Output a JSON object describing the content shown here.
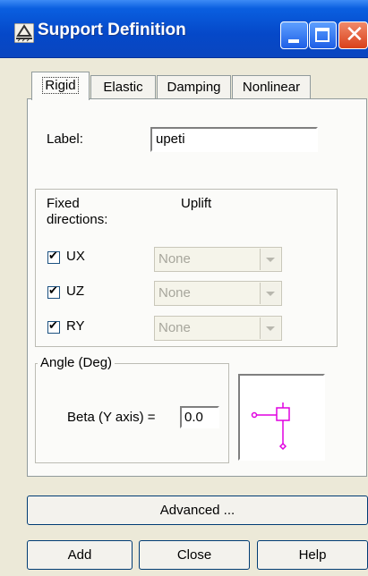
{
  "window": {
    "title": "Support Definition"
  },
  "tabs": [
    "Rigid",
    "Elastic",
    "Damping",
    "Nonlinear"
  ],
  "label_field": {
    "label": "Label:",
    "value": "upeti"
  },
  "fixed": {
    "heading": "Fixed directions:",
    "uplift_heading": "Uplift",
    "rows": [
      {
        "label": "UX",
        "checked": true,
        "uplift": "None"
      },
      {
        "label": "UZ",
        "checked": true,
        "uplift": "None"
      },
      {
        "label": "RY",
        "checked": true,
        "uplift": "None"
      }
    ]
  },
  "angle": {
    "heading": "Angle (Deg)",
    "beta_label": "Beta (Y axis) =",
    "beta_value": "0.0"
  },
  "buttons": {
    "advanced": "Advanced ...",
    "add": "Add",
    "close": "Close",
    "help": "Help"
  },
  "colors": {
    "preview_symbol": "#e000e0",
    "titlebar": "#0548c8"
  }
}
